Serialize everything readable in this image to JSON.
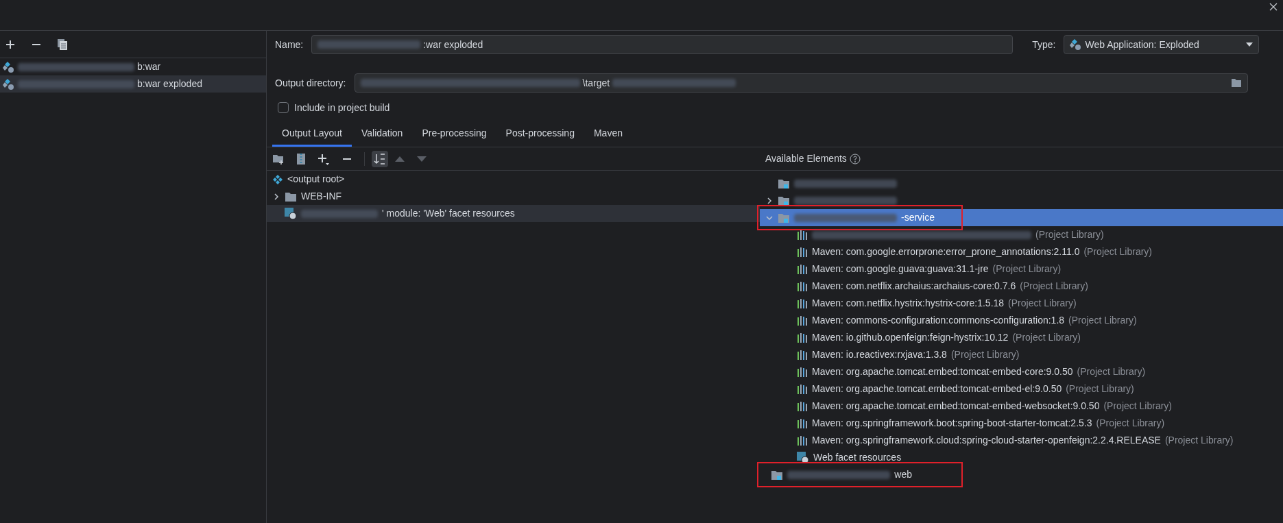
{
  "left_toolbar": {
    "buttons": [
      {
        "kind": "add"
      },
      {
        "kind": "remove"
      },
      {
        "kind": "copy"
      }
    ]
  },
  "artifacts": [
    {
      "label": "b:war",
      "selected": false
    },
    {
      "label": "b:war exploded",
      "selected": true
    }
  ],
  "name_field": {
    "label": "Name:",
    "value": ":war exploded"
  },
  "type_field": {
    "label": "Type:",
    "value": "Web Application: Exploded"
  },
  "output_directory": {
    "label": "Output directory:",
    "value_before": "\\target"
  },
  "include_in_build": {
    "label": "Include in project build",
    "checked": false
  },
  "tabs": [
    {
      "label": "Output Layout",
      "selected": true
    },
    {
      "label": "Validation",
      "selected": false
    },
    {
      "label": "Pre-processing",
      "selected": false
    },
    {
      "label": "Post-processing",
      "selected": false
    },
    {
      "label": "Maven",
      "selected": false
    }
  ],
  "layout_tree": [
    {
      "kind": "root",
      "label": "<output root>"
    },
    {
      "kind": "folder",
      "label": "WEB-INF",
      "expanded": false
    },
    {
      "kind": "facet",
      "label": "' module: 'Web' facet resources",
      "selected": true
    }
  ],
  "available_elements": {
    "title": "Available Elements",
    "items": [
      {
        "kind": "module",
        "selected": false,
        "highlighted": false
      },
      {
        "kind": "module",
        "expanded": false,
        "selected": false,
        "highlighted": false
      },
      {
        "kind": "module",
        "label": "-service",
        "expanded": true,
        "selected": true,
        "highlighted": true,
        "children": [
          {
            "kind": "library",
            "suffix": "(Project Library)"
          },
          {
            "kind": "library",
            "label": "Maven: com.google.errorprone:error_prone_annotations:2.11.0",
            "suffix": "(Project Library)"
          },
          {
            "kind": "library",
            "label": "Maven: com.google.guava:guava:31.1-jre",
            "suffix": "(Project Library)"
          },
          {
            "kind": "library",
            "label": "Maven: com.netflix.archaius:archaius-core:0.7.6",
            "suffix": "(Project Library)"
          },
          {
            "kind": "library",
            "label": "Maven: com.netflix.hystrix:hystrix-core:1.5.18",
            "suffix": "(Project Library)"
          },
          {
            "kind": "library",
            "label": "Maven: commons-configuration:commons-configuration:1.8",
            "suffix": "(Project Library)"
          },
          {
            "kind": "library",
            "label": "Maven: io.github.openfeign:feign-hystrix:10.12",
            "suffix": "(Project Library)"
          },
          {
            "kind": "library",
            "label": "Maven: io.reactivex:rxjava:1.3.8",
            "suffix": "(Project Library)"
          },
          {
            "kind": "library",
            "label": "Maven: org.apache.tomcat.embed:tomcat-embed-core:9.0.50",
            "suffix": "(Project Library)"
          },
          {
            "kind": "library",
            "label": "Maven: org.apache.tomcat.embed:tomcat-embed-el:9.0.50",
            "suffix": "(Project Library)"
          },
          {
            "kind": "library",
            "label": "Maven: org.apache.tomcat.embed:tomcat-embed-websocket:9.0.50",
            "suffix": "(Project Library)"
          },
          {
            "kind": "library",
            "label": "Maven: org.springframework.boot:spring-boot-starter-tomcat:2.5.3",
            "suffix": "(Project Library)"
          },
          {
            "kind": "library",
            "label": "Maven: org.springframework.cloud:spring-cloud-starter-openfeign:2.2.4.RELEASE",
            "suffix": "(Project Library)"
          },
          {
            "kind": "facet",
            "label": "Web facet resources"
          }
        ]
      },
      {
        "kind": "module",
        "label": "web",
        "selected": false,
        "highlighted": true
      }
    ]
  }
}
